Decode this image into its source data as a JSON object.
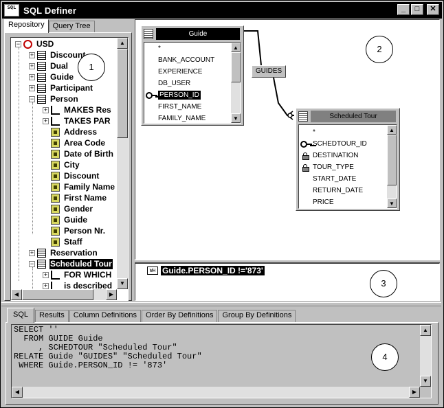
{
  "window": {
    "icon_text": "SQL",
    "title": "SQL Definer",
    "buttons": [
      "_",
      "□",
      "✕"
    ]
  },
  "left_panel": {
    "tabs": [
      "Repository",
      "Query Tree"
    ],
    "active_tab": "Repository",
    "tree": [
      {
        "label": "USD",
        "icon": "database-icon",
        "level": 0,
        "expander": "−"
      },
      {
        "label": "Discount",
        "icon": "table-icon",
        "level": 1,
        "expander": "+"
      },
      {
        "label": "Dual",
        "icon": "table-icon",
        "level": 1,
        "expander": "+"
      },
      {
        "label": "Guide",
        "icon": "table-icon",
        "level": 1,
        "expander": "+"
      },
      {
        "label": "Participant",
        "icon": "table-icon",
        "level": 1,
        "expander": "+"
      },
      {
        "label": "Person",
        "icon": "table-icon",
        "level": 1,
        "expander": "−"
      },
      {
        "label": "MAKES Res",
        "icon": "relation-icon",
        "level": 2,
        "expander": "+"
      },
      {
        "label": "TAKES PAR",
        "icon": "relation-icon",
        "level": 2,
        "expander": "+"
      },
      {
        "label": "Address",
        "icon": "column-icon",
        "level": 2,
        "expander": ""
      },
      {
        "label": "Area Code",
        "icon": "column-icon",
        "level": 2,
        "expander": ""
      },
      {
        "label": "Date of Birth",
        "icon": "column-icon",
        "level": 2,
        "expander": ""
      },
      {
        "label": "City",
        "icon": "column-icon",
        "level": 2,
        "expander": ""
      },
      {
        "label": "Discount",
        "icon": "column-icon",
        "level": 2,
        "expander": ""
      },
      {
        "label": "Family Name",
        "icon": "column-icon",
        "level": 2,
        "expander": ""
      },
      {
        "label": "First Name",
        "icon": "column-icon",
        "level": 2,
        "expander": ""
      },
      {
        "label": "Gender",
        "icon": "column-icon",
        "level": 2,
        "expander": ""
      },
      {
        "label": "Guide",
        "icon": "column-icon",
        "level": 2,
        "expander": ""
      },
      {
        "label": "Person Nr.",
        "icon": "column-icon",
        "level": 2,
        "expander": ""
      },
      {
        "label": "Staff",
        "icon": "column-icon",
        "level": 2,
        "expander": ""
      },
      {
        "label": "Reservation",
        "icon": "table-icon",
        "level": 1,
        "expander": "+"
      },
      {
        "label": "Scheduled Tour",
        "icon": "table-icon",
        "level": 1,
        "expander": "−",
        "selected": true
      },
      {
        "label": "FOR WHICH",
        "icon": "relation-icon",
        "level": 2,
        "expander": "+"
      },
      {
        "label": "is described",
        "icon": "relation-icon",
        "level": 2,
        "expander": "+"
      }
    ]
  },
  "diagram": {
    "guide": {
      "title": "Guide",
      "fields": [
        {
          "name": "*",
          "key": false
        },
        {
          "name": "BANK_ACCOUNT",
          "key": false
        },
        {
          "name": "EXPERIENCE",
          "key": false
        },
        {
          "name": "DB_USER",
          "key": false
        },
        {
          "name": "PERSON_ID",
          "key": true,
          "selected": true
        },
        {
          "name": "FIRST_NAME",
          "key": false
        },
        {
          "name": "FAMILY_NAME",
          "key": false
        }
      ]
    },
    "scheduled_tour": {
      "title": "Scheduled Tour",
      "fields": [
        {
          "name": "*",
          "marker": "none"
        },
        {
          "name": "SCHEDTOUR_ID",
          "marker": "key"
        },
        {
          "name": "DESTINATION",
          "marker": "lock"
        },
        {
          "name": "TOUR_TYPE",
          "marker": "lock"
        },
        {
          "name": "START_DATE",
          "marker": "none"
        },
        {
          "name": "RETURN_DATE",
          "marker": "none"
        },
        {
          "name": "PRICE",
          "marker": "none"
        }
      ]
    },
    "relationship_label": "GUIDES"
  },
  "where_clause": {
    "icon_text": "WH",
    "text": "Guide.PERSON_ID !='873'"
  },
  "bottom_panel": {
    "tabs": [
      "SQL",
      "Results",
      "Column Definitions",
      "Order By Definitions",
      "Group By Definitions"
    ],
    "active_tab": "SQL",
    "sql_lines": [
      "SELECT ''",
      "  FROM GUIDE Guide",
      "     , SCHEDTOUR \"Scheduled Tour\"",
      "RELATE Guide \"GUIDES\" \"Scheduled Tour\"",
      " WHERE Guide.PERSON_ID != '873'"
    ]
  },
  "callouts": [
    "1",
    "2",
    "3",
    "4"
  ]
}
